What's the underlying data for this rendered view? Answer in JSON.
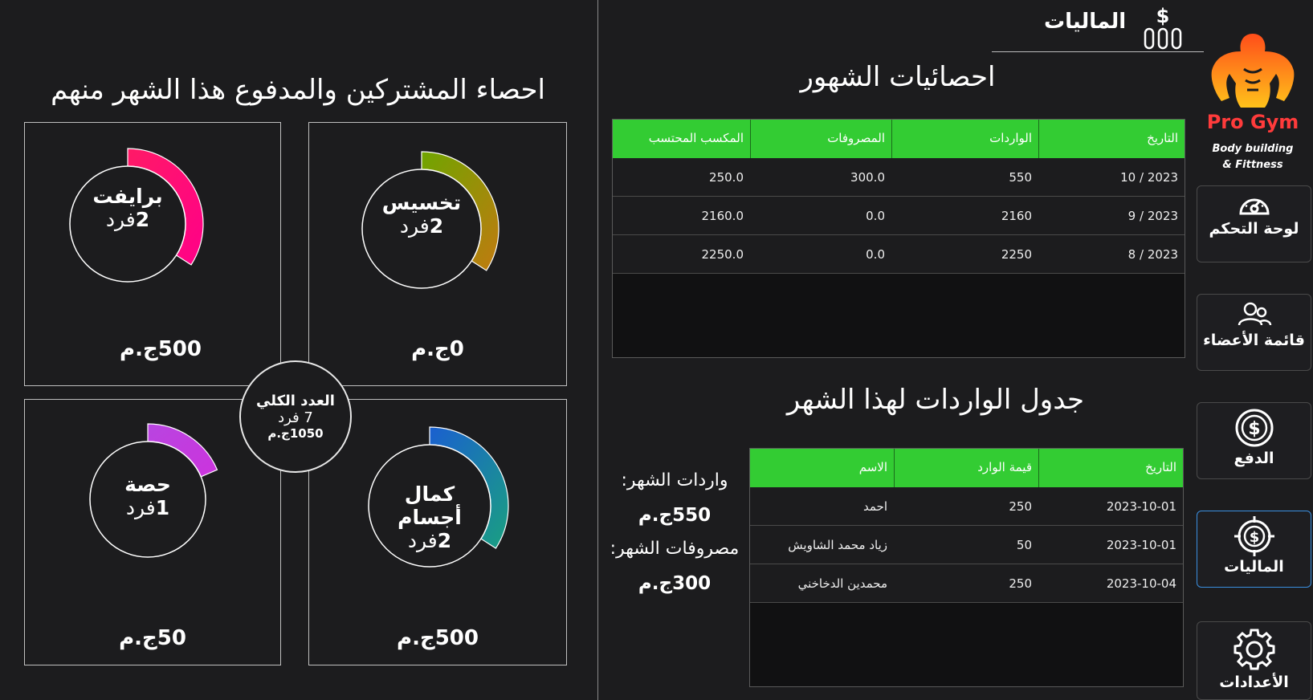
{
  "header": {
    "title": "الماليات"
  },
  "brand": {
    "name": "Pro Gym",
    "tagline_1": "Body building",
    "tagline_2": "& Fittness"
  },
  "sidebar": {
    "items": [
      {
        "label": "لوحة التحكم",
        "icon": "dashboard-gauge-icon"
      },
      {
        "label": "قائمة الأعضاء",
        "icon": "members-icon"
      },
      {
        "label": "الدفع",
        "icon": "dollar-coin-icon"
      },
      {
        "label": "الماليات",
        "icon": "finance-target-icon",
        "active": true
      },
      {
        "label": "الأعدادات",
        "icon": "settings-gear-icon"
      }
    ]
  },
  "stats": {
    "title": "احصاء المشتركين والمدفوع هذا الشهر منهم",
    "categories": [
      {
        "name": "برايفت",
        "count_value": "2",
        "count_unit": "فرد",
        "amount": "500ج.م",
        "progress": 0.55,
        "gradient": [
          "#ff1a66",
          "#ff0088"
        ]
      },
      {
        "name": "تخسيس",
        "count_value": "2",
        "count_unit": "فرد",
        "amount": "0ج.م",
        "progress": 0.55,
        "gradient": [
          "#6fa500",
          "#c07a10"
        ]
      },
      {
        "name": "حصة",
        "count_value": "1",
        "count_unit": "فرد",
        "amount": "50ج.م",
        "progress": 0.3,
        "gradient": [
          "#b845e0",
          "#cc33dd"
        ]
      },
      {
        "name": "كمال أجسام",
        "count_value": "2",
        "count_unit": "فرد",
        "amount": "500ج.م",
        "progress": 0.55,
        "gradient": [
          "#1a5fd0",
          "#1aa080"
        ]
      }
    ],
    "total": {
      "title": "العدد الكلي",
      "count": "7 فرد",
      "amount": "1050ج.م"
    }
  },
  "monthly_stats": {
    "title": "احصائيات الشهور",
    "columns": [
      "التاريخ",
      "الواردات",
      "المصروفات",
      "المكسب المحتسب"
    ],
    "rows": [
      [
        "2023 / 10",
        "550",
        "300.0",
        "250.0"
      ],
      [
        "2023 / 9",
        "2160",
        "0.0",
        "2160.0"
      ],
      [
        "2023 / 8",
        "2250",
        "0.0",
        "2250.0"
      ]
    ]
  },
  "income_table": {
    "title": "جدول الواردات لهذا الشهر",
    "columns": [
      "التاريخ",
      "قيمة الوارد",
      "الاسم"
    ],
    "rows": [
      [
        "2023-10-01",
        "250",
        "احمد"
      ],
      [
        "2023-10-01",
        "50",
        "زياد محمد الشاويش"
      ],
      [
        "2023-10-04",
        "250",
        "محمدين الدخاخني"
      ]
    ]
  },
  "summary": {
    "income_label": "واردات الشهر:",
    "income_value": "550ج.م",
    "expenses_label": "مصروفات الشهر:",
    "expenses_value": "300ج.م"
  },
  "colors": {
    "background": "#1c1c1e",
    "table_header": "#33cc33",
    "brand": "#ff3b3b",
    "active_border": "#3a8fe0"
  }
}
